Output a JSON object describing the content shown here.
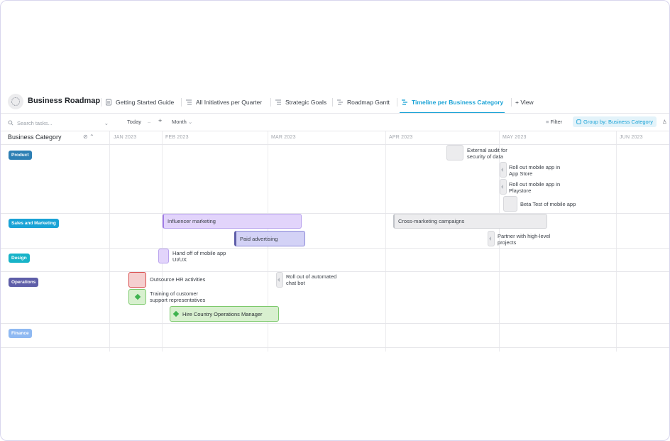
{
  "header": {
    "space_title": "Business Roadmap",
    "tabs": [
      {
        "label": "Getting Started Guide"
      },
      {
        "label": "All Initiatives per Quarter"
      },
      {
        "label": "Strategic Goals"
      },
      {
        "label": "Roadmap Gantt"
      },
      {
        "label": "Timeline per Business Category",
        "active": true
      }
    ],
    "add_view_label": "+ View"
  },
  "toolbar": {
    "search_placeholder": "Search tasks...",
    "today_label": "Today",
    "zoom_label": "Month",
    "filter_label": "Filter",
    "group_by_label": "Group by: Business Category"
  },
  "timeline": {
    "group_header": "Business Category",
    "months": [
      "JAN 2023",
      "FEB 2023",
      "MAR 2023",
      "APR 2023",
      "MAY 2023",
      "JUN 2023"
    ],
    "groups": [
      {
        "name": "Product",
        "color": "#2d7fb4"
      },
      {
        "name": "Sales and Marketing",
        "color": "#1aa3d6"
      },
      {
        "name": "Design",
        "color": "#17b3c8"
      },
      {
        "name": "Operations",
        "color": "#5e5ea8"
      },
      {
        "name": "Finance",
        "color": "#8fb9f2"
      }
    ],
    "tasks": {
      "external_audit": "External audit for\nsecurity of data",
      "app_store": "Roll out mobile app in\nApp Store",
      "playstore": "Roll out mobile app in\nPlaystore",
      "beta_test": "Beta Test of mobile app",
      "influencer": "Influencer marketing",
      "paid_ads": "Paid advertising",
      "cross_marketing": "Cross-marketing campaigns",
      "partner": "Partner with high-level\nprojects",
      "handoff": "Hand off of mobile app\nUI/UX",
      "outsource_hr": "Outsource HR activities",
      "chat_bot": "Roll out of automated\nchat bot",
      "training": "Training of customer\nsupport representatives",
      "hire_ops": "Hire Country Operations Manager"
    }
  },
  "colors": {
    "accent": "#1aa3d6",
    "purple_bar": "#e2d4fb",
    "indigo_bar": "#d3d2f6",
    "gray_bar": "#ececee",
    "red_ms": "#f5cfcf",
    "green_bar": "#d8f0cf"
  }
}
